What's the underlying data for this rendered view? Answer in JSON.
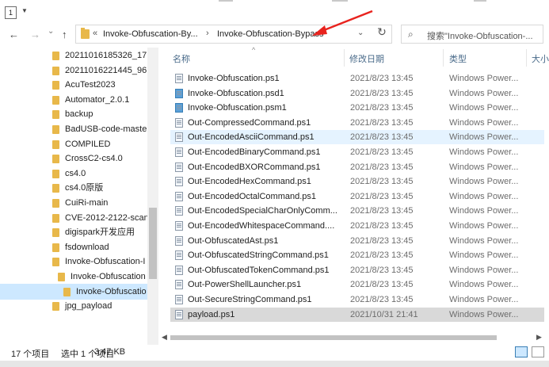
{
  "quick_access": {
    "badge": "1"
  },
  "nav_buttons": {
    "back": "←",
    "forward": "→",
    "dropdown": "⌄",
    "up": "↑"
  },
  "address": {
    "overflow": "«",
    "seg1": "Invoke-Obfuscation-By...",
    "sep": "›",
    "seg2": "Invoke-Obfuscation-Bypass",
    "dropdown": "⌄",
    "refresh": "↻"
  },
  "search": {
    "placeholder": "搜索\"Invoke-Obfuscation-..."
  },
  "columns": {
    "name": "名称",
    "date": "修改日期",
    "type": "类型",
    "size": "大小"
  },
  "nav_items": [
    {
      "label": "20211016185326_17",
      "level": 0
    },
    {
      "label": "20211016221445_96",
      "level": 0
    },
    {
      "label": "AcuTest2023",
      "level": 0
    },
    {
      "label": "Automator_2.0.1",
      "level": 0
    },
    {
      "label": "backup",
      "level": 0
    },
    {
      "label": "BadUSB-code-maste",
      "level": 0
    },
    {
      "label": "COMPILED",
      "level": 0
    },
    {
      "label": "CrossC2-cs4.0",
      "level": 0
    },
    {
      "label": "cs4.0",
      "level": 0
    },
    {
      "label": "cs4.0原版",
      "level": 0
    },
    {
      "label": "CuiRi-main",
      "level": 0
    },
    {
      "label": "CVE-2012-2122-scan",
      "level": 0
    },
    {
      "label": "digispark开发应用",
      "level": 0
    },
    {
      "label": "fsdownload",
      "level": 0
    },
    {
      "label": "Invoke-Obfuscation-I",
      "level": 0
    },
    {
      "label": "Invoke-Obfuscation",
      "level": 1
    },
    {
      "label": "Invoke-Obfuscatio",
      "level": 2,
      "selected": true
    },
    {
      "label": "jpg_payload",
      "level": 0
    }
  ],
  "files": [
    {
      "name": "Invoke-Obfuscation.ps1",
      "date": "2021/8/23 13:45",
      "type": "Windows Power..."
    },
    {
      "name": "Invoke-Obfuscation.psd1",
      "date": "2021/8/23 13:45",
      "type": "Windows Power...",
      "icon": "blue"
    },
    {
      "name": "Invoke-Obfuscation.psm1",
      "date": "2021/8/23 13:45",
      "type": "Windows Power...",
      "icon": "blue"
    },
    {
      "name": "Out-CompressedCommand.ps1",
      "date": "2021/8/23 13:45",
      "type": "Windows Power..."
    },
    {
      "name": "Out-EncodedAsciiCommand.ps1",
      "date": "2021/8/23 13:45",
      "type": "Windows Power...",
      "hover": true
    },
    {
      "name": "Out-EncodedBinaryCommand.ps1",
      "date": "2021/8/23 13:45",
      "type": "Windows Power..."
    },
    {
      "name": "Out-EncodedBXORCommand.ps1",
      "date": "2021/8/23 13:45",
      "type": "Windows Power..."
    },
    {
      "name": "Out-EncodedHexCommand.ps1",
      "date": "2021/8/23 13:45",
      "type": "Windows Power..."
    },
    {
      "name": "Out-EncodedOctalCommand.ps1",
      "date": "2021/8/23 13:45",
      "type": "Windows Power..."
    },
    {
      "name": "Out-EncodedSpecialCharOnlyComm...",
      "date": "2021/8/23 13:45",
      "type": "Windows Power..."
    },
    {
      "name": "Out-EncodedWhitespaceCommand....",
      "date": "2021/8/23 13:45",
      "type": "Windows Power..."
    },
    {
      "name": "Out-ObfuscatedAst.ps1",
      "date": "2021/8/23 13:45",
      "type": "Windows Power..."
    },
    {
      "name": "Out-ObfuscatedStringCommand.ps1",
      "date": "2021/8/23 13:45",
      "type": "Windows Power..."
    },
    {
      "name": "Out-ObfuscatedTokenCommand.ps1",
      "date": "2021/8/23 13:45",
      "type": "Windows Power..."
    },
    {
      "name": "Out-PowerShellLauncher.ps1",
      "date": "2021/8/23 13:45",
      "type": "Windows Power..."
    },
    {
      "name": "Out-SecureStringCommand.ps1",
      "date": "2021/8/23 13:45",
      "type": "Windows Power..."
    },
    {
      "name": "payload.ps1",
      "date": "2021/10/31 21:41",
      "type": "Windows Power...",
      "selected": true
    }
  ],
  "status": {
    "count": "17 个项目",
    "selected": "选中 1 个项目",
    "size": "3.47 KB"
  },
  "scroll": {
    "left": "◀",
    "right": "▶"
  },
  "colors": {
    "folder": "#e8b84a",
    "selection": "#cde8ff",
    "hover": "#e5f3ff",
    "selected_row": "#d9d9d9",
    "annotation": "#e8231e"
  }
}
